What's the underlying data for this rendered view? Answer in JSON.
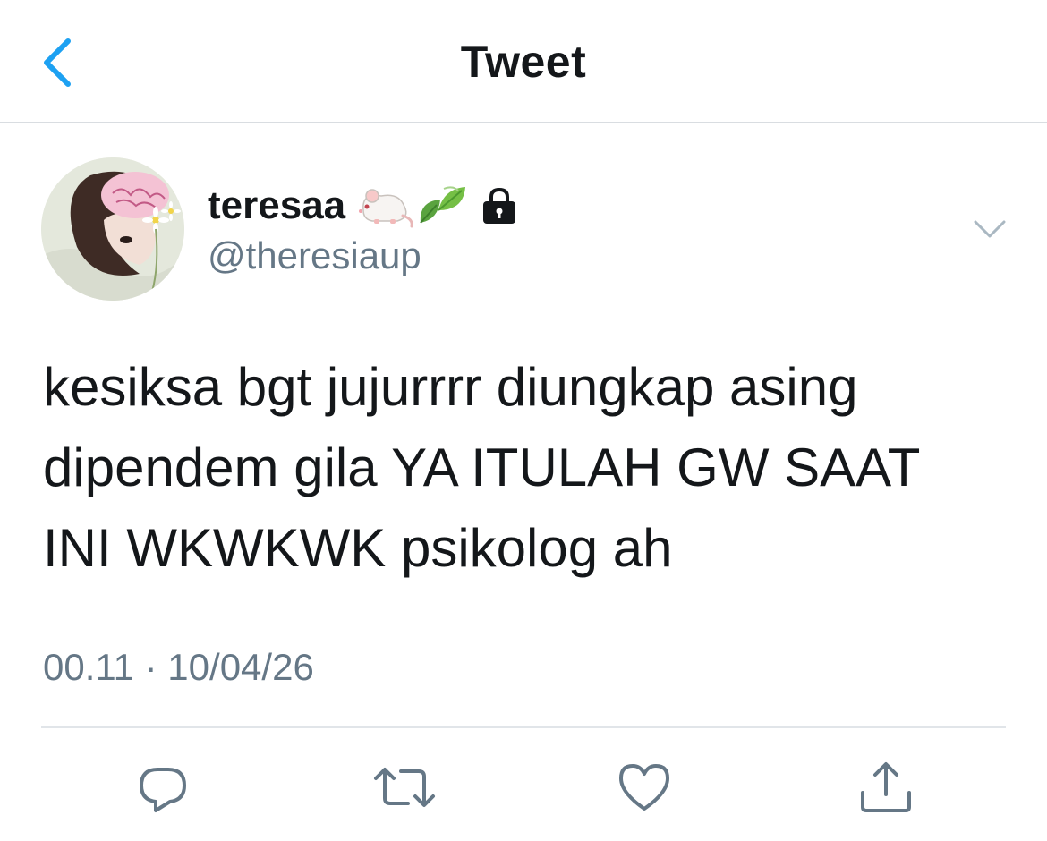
{
  "header": {
    "title": "Tweet",
    "back_icon": "chevron-left-icon",
    "accent_color": "#1da1f2"
  },
  "tweet": {
    "author": {
      "display_name": "teresaa",
      "name_emojis": [
        "rat-emoji",
        "leaf-emoji",
        "lock-icon"
      ],
      "handle": "@theresiaup",
      "protected": true
    },
    "text": "kesiksa bgt jujurrrr diungkap asing\ndipendem gila YA ITULAH GW SAAT\nINI WKWKWK psikolog ah",
    "timestamp": "00.11 · 10/04/26",
    "more_icon": "chevron-down-icon"
  },
  "actions": [
    {
      "name": "reply",
      "icon": "reply-icon"
    },
    {
      "name": "retweet",
      "icon": "retweet-icon"
    },
    {
      "name": "like",
      "icon": "heart-icon"
    },
    {
      "name": "share",
      "icon": "share-icon"
    }
  ],
  "colors": {
    "text": "#14171a",
    "secondary": "#657786",
    "divider": "#e1e5e9"
  }
}
